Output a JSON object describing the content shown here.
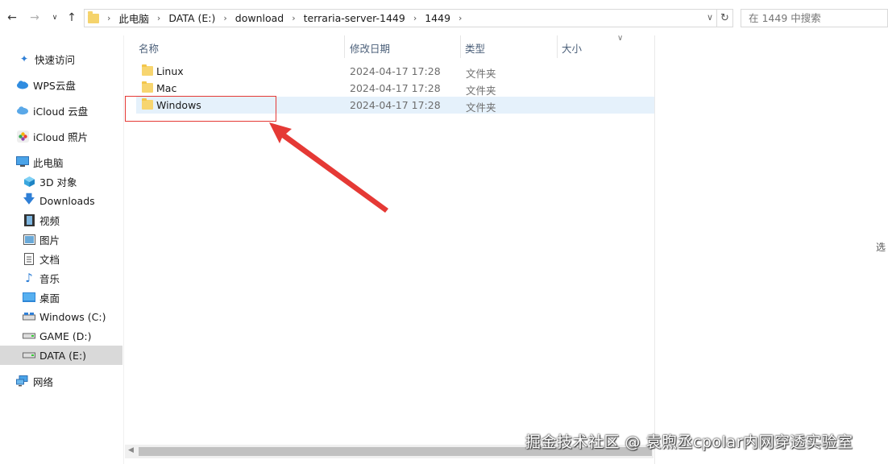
{
  "address_bar": {
    "breadcrumbs": [
      "此电脑",
      "DATA (E:)",
      "download",
      "terraria-server-1449",
      "1449"
    ]
  },
  "search": {
    "placeholder": "在 1449 中搜索"
  },
  "sidebar": {
    "items": [
      {
        "label": "快速访问",
        "icon": "pin-icon"
      },
      {
        "label": "WPS云盘",
        "icon": "cloud-icon"
      },
      {
        "label": "iCloud 云盘",
        "icon": "icloud-icon"
      },
      {
        "label": "iCloud 照片",
        "icon": "photos-icon"
      },
      {
        "label": "此电脑",
        "icon": "computer-icon"
      },
      {
        "label": "3D 对象",
        "icon": "cube-icon"
      },
      {
        "label": "Downloads",
        "icon": "download-icon"
      },
      {
        "label": "视频",
        "icon": "video-icon"
      },
      {
        "label": "图片",
        "icon": "picture-icon"
      },
      {
        "label": "文档",
        "icon": "document-icon"
      },
      {
        "label": "音乐",
        "icon": "music-icon"
      },
      {
        "label": "桌面",
        "icon": "desktop-icon"
      },
      {
        "label": "Windows (C:)",
        "icon": "drive-icon"
      },
      {
        "label": "GAME (D:)",
        "icon": "drive-icon"
      },
      {
        "label": "DATA (E:)",
        "icon": "drive-icon",
        "selected": true
      },
      {
        "label": "网络",
        "icon": "network-icon"
      }
    ]
  },
  "columns": {
    "name": "名称",
    "date": "修改日期",
    "type": "类型",
    "size": "大小"
  },
  "files": [
    {
      "name": "Linux",
      "date": "2024-04-17 17:28",
      "type": "文件夹"
    },
    {
      "name": "Mac",
      "date": "2024-04-17 17:28",
      "type": "文件夹"
    },
    {
      "name": "Windows",
      "date": "2024-04-17 17:28",
      "type": "文件夹",
      "selected": true
    }
  ],
  "clipped_text": "选",
  "watermark": "掘金技术社区 @ 袁煦丞cpolar内网穿透实验室",
  "colors": {
    "highlight": "#e53935",
    "arrow": "#e53935",
    "selection": "#e5f1fb",
    "folder": "#f7d56f"
  }
}
